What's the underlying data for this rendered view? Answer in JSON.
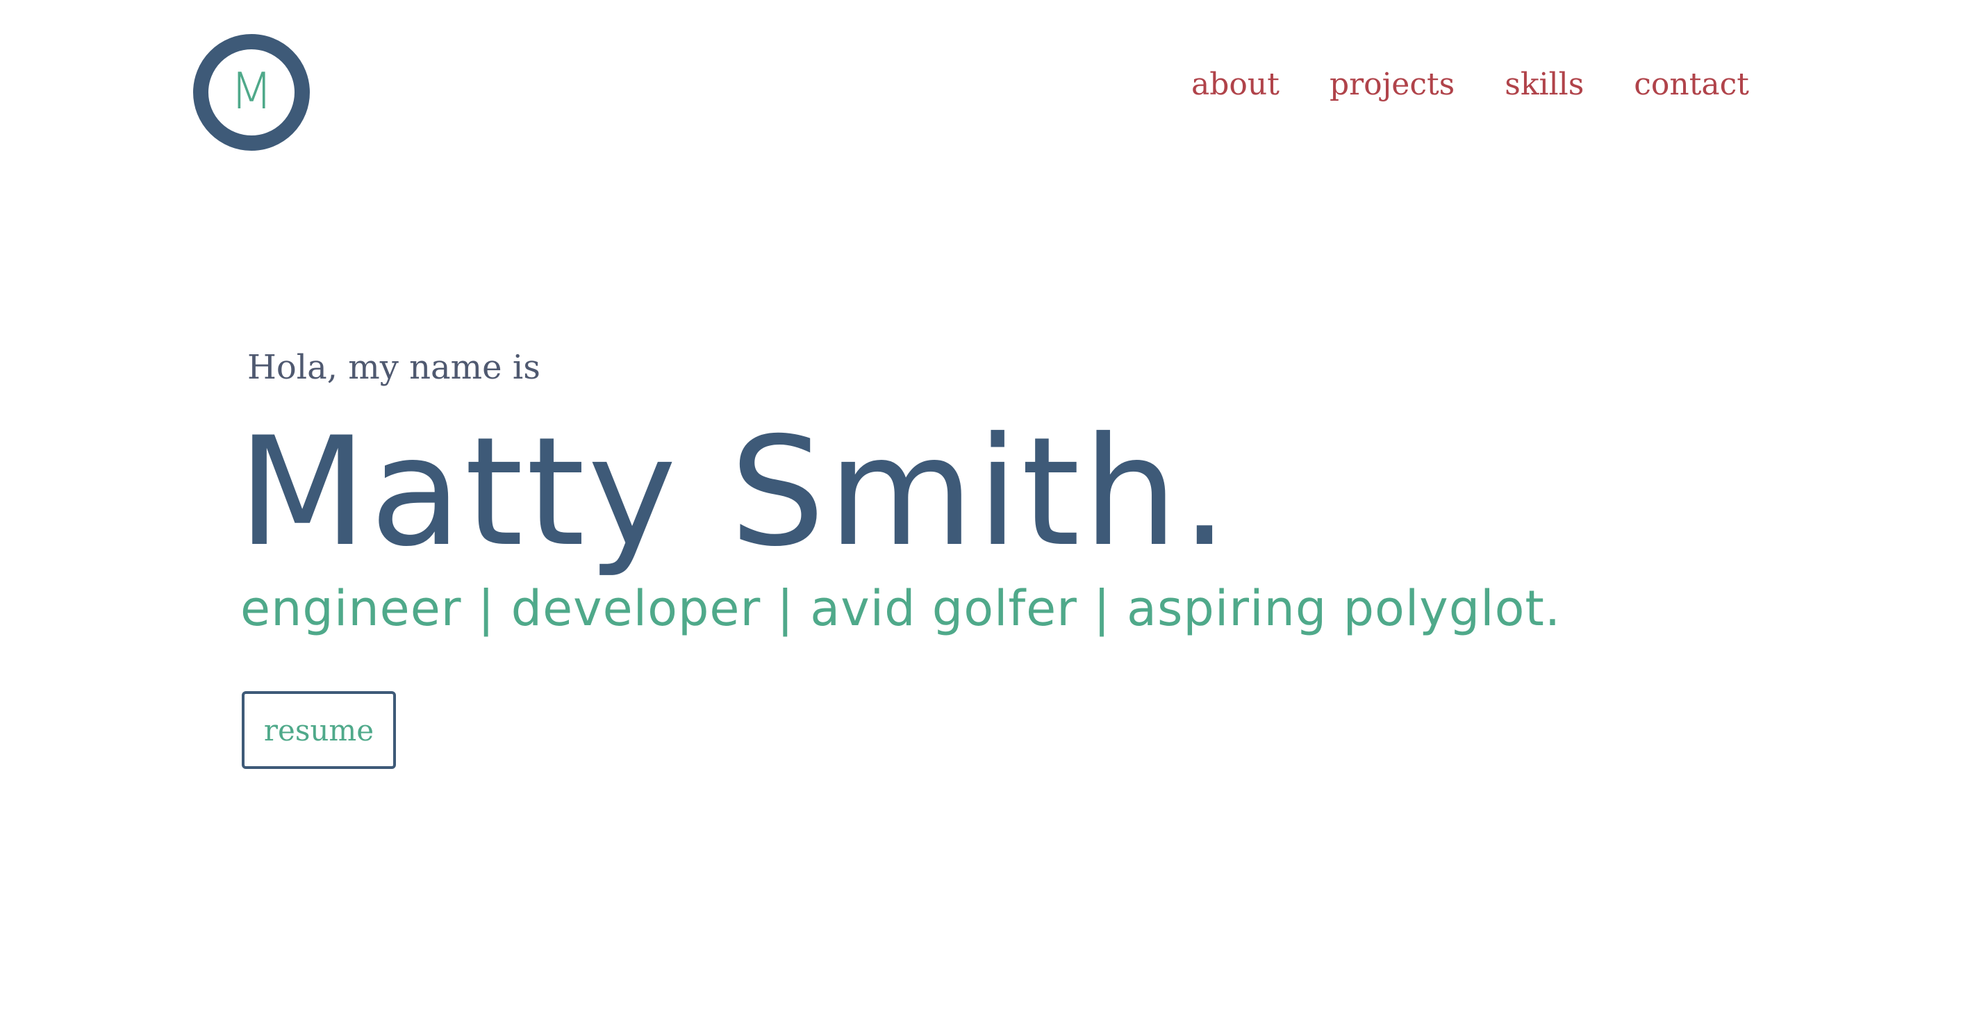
{
  "logo": {
    "letter": "M"
  },
  "nav": {
    "items": [
      {
        "label": "about"
      },
      {
        "label": "projects"
      },
      {
        "label": "skills"
      },
      {
        "label": "contact"
      }
    ]
  },
  "hero": {
    "greeting": "Hola, my name is",
    "name": "Matty Smith.",
    "tagline": "engineer | developer | avid golfer | aspiring polyglot.",
    "resume_label": "resume"
  },
  "colors": {
    "primary": "#3e5a78",
    "accent": "#4fa98a",
    "nav": "#b0434a",
    "muted_text": "#4f5970",
    "background": "#ffffff"
  }
}
